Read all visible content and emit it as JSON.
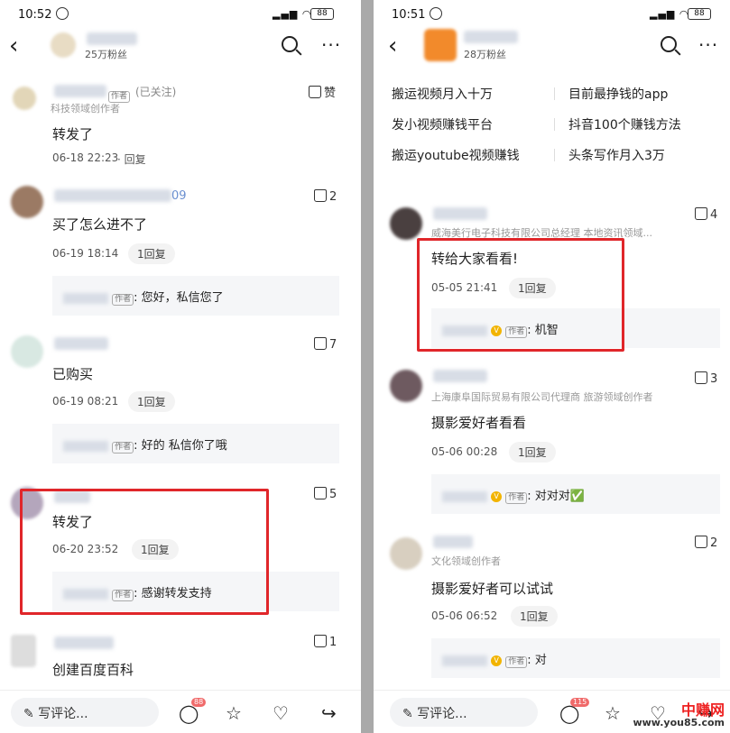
{
  "left": {
    "status": {
      "time": "10:52",
      "battery": "88"
    },
    "header": {
      "fans": "25万粉丝"
    },
    "comments": [
      {
        "text": "转发了",
        "role": "科技领域创作者",
        "follow": "(已关注)",
        "author_tag": "作者",
        "likes": "赞",
        "date": "06-18 22:23",
        "reply_label": "回复"
      },
      {
        "text": "买了怎么进不了",
        "name_suffix": "09",
        "likes": "2",
        "date": "06-19 18:14",
        "reply_btn": "1回复",
        "reply": {
          "tag": "作者",
          "text": ": 您好，私信您了"
        }
      },
      {
        "text": "已购买",
        "likes": "7",
        "date": "06-19 08:21",
        "reply_btn": "1回复",
        "reply": {
          "tag": "作者",
          "text": ": 好的 私信你了哦"
        }
      },
      {
        "text": "转发了",
        "likes": "5",
        "date": "06-20 23:52",
        "reply_btn": "1回复",
        "reply": {
          "tag": "作者",
          "text": ": 感谢转发支持"
        }
      },
      {
        "text": "创建百度百科",
        "likes": "1"
      }
    ],
    "bottom": {
      "placeholder": "写评论...",
      "comment_count": "88"
    }
  },
  "right": {
    "status": {
      "time": "10:51",
      "battery": "88"
    },
    "header": {
      "fans": "28万粉丝"
    },
    "keywords": [
      "搬运视频月入十万",
      "目前最挣钱的app",
      "发小视频赚钱平台",
      "抖音100个赚钱方法",
      "搬运youtube视频赚钱",
      "头条写作月入3万"
    ],
    "comments": [
      {
        "role": "威海美行电子科技有限公司总经理 本地资讯领域...",
        "text": "转给大家看看!",
        "likes": "4",
        "date": "05-05 21:41",
        "reply_btn": "1回复",
        "reply": {
          "tag": "作者",
          "text": ": 机智"
        }
      },
      {
        "role": "上海康阜国际贸易有限公司代理商 旅游领域创作者",
        "text": "摄影爱好者看看",
        "likes": "3",
        "date": "05-06 00:28",
        "reply_btn": "1回复",
        "reply": {
          "tag": "作者",
          "text": ": 对对对✅"
        }
      },
      {
        "role": "文化领域创作者",
        "text": "摄影爱好者可以试试",
        "likes": "2",
        "date": "05-06 06:52",
        "reply_btn": "1回复",
        "reply": {
          "tag": "作者",
          "text": ": 对"
        }
      }
    ],
    "bottom": {
      "placeholder": "写评论...",
      "comment_count": "115"
    }
  },
  "watermark": {
    "line1": "中赚网",
    "line2": "www.you85.com"
  },
  "colors": {
    "highlight": "#e0262a",
    "reply_bg": "#f5f6f8",
    "vip": "#f2b400"
  }
}
